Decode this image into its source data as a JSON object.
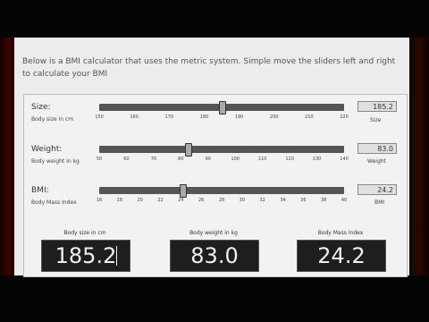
{
  "intro": {
    "text": "Below is a BMI calculator that uses the metric system. Simple move the sliders left and right to calculate your BMI"
  },
  "sliders": [
    {
      "label": "Size:",
      "sublabel": "Body size in cm",
      "ticks": [
        "150",
        "160",
        "170",
        "180",
        "190",
        "200",
        "210",
        "220"
      ],
      "min": 150,
      "max": 220,
      "value": 185.2,
      "value_text": "185.2",
      "tag": "Size"
    },
    {
      "label": "Weight:",
      "sublabel": "Body weight in kg",
      "ticks": [
        "50",
        "60",
        "70",
        "80",
        "90",
        "100",
        "110",
        "120",
        "130",
        "140"
      ],
      "min": 50,
      "max": 140,
      "value": 83.0,
      "value_text": "83.0",
      "tag": "Weight"
    },
    {
      "label": "BMI:",
      "sublabel": "Body Mass Index",
      "ticks": [
        "16",
        "18",
        "20",
        "22",
        "24",
        "26",
        "28",
        "30",
        "32",
        "34",
        "36",
        "38",
        "40"
      ],
      "min": 16,
      "max": 40,
      "value": 24.2,
      "value_text": "24.2",
      "tag": "BMI"
    }
  ],
  "displays": [
    {
      "caption": "Body size in cm",
      "value": "185.2"
    },
    {
      "caption": "Body weight in kg",
      "value": "83.0"
    },
    {
      "caption": "Body Mass Index",
      "value": "24.2"
    }
  ]
}
